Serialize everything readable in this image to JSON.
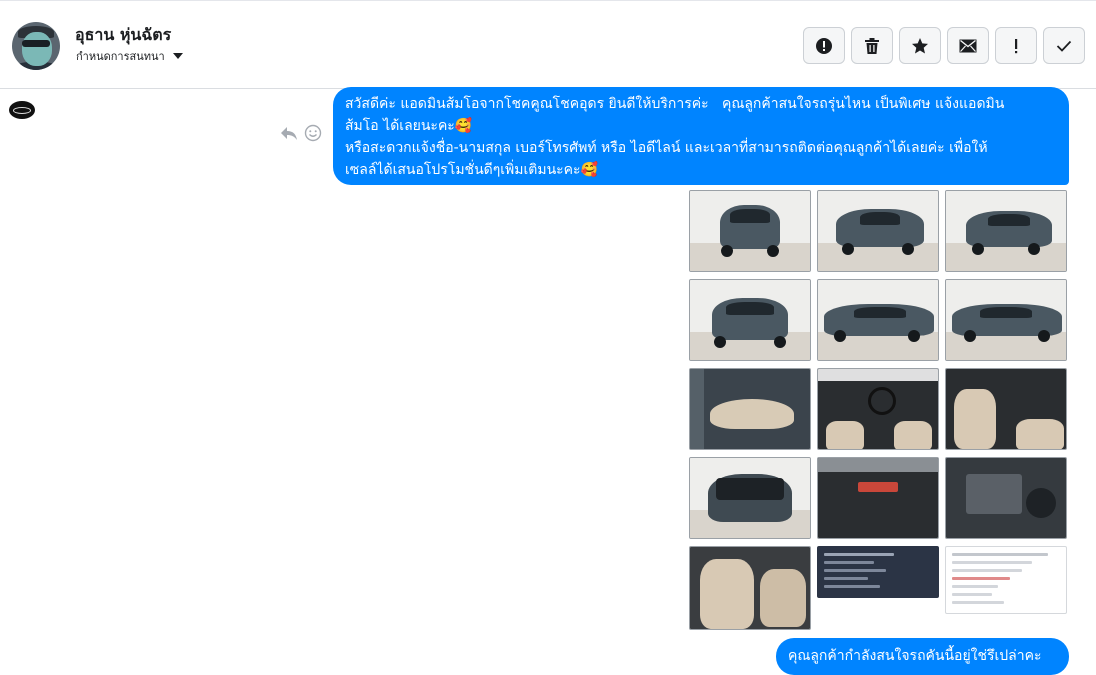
{
  "header": {
    "user_name": "อุธาน หุ่นฉัตร",
    "conversation_label": "กำหนดการสนทนา"
  },
  "actions": [
    {
      "name": "spam-button",
      "icon": "exclamation-circle-icon"
    },
    {
      "name": "delete-button",
      "icon": "trash-icon"
    },
    {
      "name": "star-button",
      "icon": "star-icon"
    },
    {
      "name": "mark-unread-button",
      "icon": "envelope-icon"
    },
    {
      "name": "follow-up-button",
      "icon": "exclamation-icon"
    },
    {
      "name": "done-button",
      "icon": "checkmark-icon"
    }
  ],
  "messages": {
    "greeting": {
      "line1": "สวัสดีค่ะ แอดมินส้มโอจากโชคคูณโชคอุดร ยินดีให้บริการค่ะ   คุณลูกค้าสนใจรถรุ่นไหน เป็นพิเศษ แจ้งแอดมิน",
      "line2": "ส้มโอ ได้เลยนะคะ🥰",
      "line3": "หรือสะดวกแจ้งชื่อ-นามสกุล เบอร์โทรศัพท์ หรือ ไอดีไลน์ และเวลาที่สามารถติดต่อคุณลูกค้าได้เลยค่ะ เพื่อให้",
      "line4": "เซลล์ได้เสนอโปรโมชั่นดีๆเพิ่มเติมนะคะ🥰"
    },
    "question": "คุณลูกค้ากำลังสนใจรถคันนี้อยู่ใช่รึเปล่าคะ"
  },
  "photos": [
    {
      "subject": "car-front"
    },
    {
      "subject": "car-front-left"
    },
    {
      "subject": "car-rear-left"
    },
    {
      "subject": "car-rear"
    },
    {
      "subject": "car-side-right"
    },
    {
      "subject": "car-side-left"
    },
    {
      "subject": "door-panel"
    },
    {
      "subject": "dashboard"
    },
    {
      "subject": "front-seats"
    },
    {
      "subject": "engine-bay-open"
    },
    {
      "subject": "center-console"
    },
    {
      "subject": "engine-closeup"
    },
    {
      "subject": "rear-seats"
    },
    {
      "subject": "document-screenshot-dark"
    },
    {
      "subject": "document-screenshot-light"
    }
  ],
  "colors": {
    "bubble": "#0084ff",
    "bubble_text": "#ffffff",
    "car_body": "#4a5862"
  }
}
